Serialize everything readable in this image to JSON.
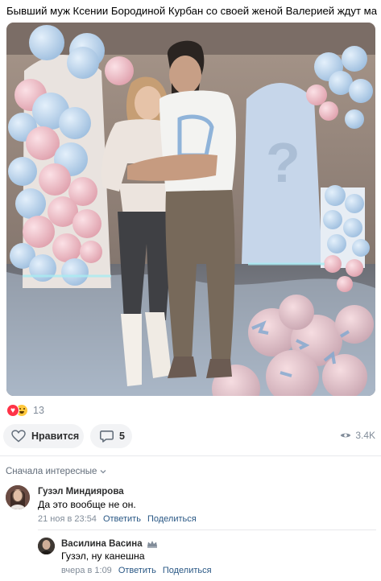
{
  "post": {
    "text": "Бывший муж Ксении Бородиной Курбан со своей женой Валерией ждут малыша😱"
  },
  "reactions": {
    "icons": [
      "heart-reaction",
      "laugh-reaction"
    ],
    "count": "13"
  },
  "actions": {
    "like_label": "Нравится",
    "comment_count": "5",
    "views": "3.4K"
  },
  "comments": {
    "sort_label": "Сначала интересные",
    "items": [
      {
        "author": "Гузэл Миндиярова",
        "text": "Да это вообще не он.",
        "time": "21 ноя в 23:54",
        "reply_label": "Ответить",
        "share_label": "Поделиться"
      },
      {
        "author": "Василина Васина",
        "text": "Гузэл, ну канешна",
        "time": "вчера в 1:09",
        "reply_label": "Ответить",
        "share_label": "Поделиться"
      }
    ]
  },
  "colors": {
    "accent_link": "#2a5885",
    "muted": "#818c99",
    "heart": "#ff3347",
    "button_bg": "#f2f3f5"
  }
}
